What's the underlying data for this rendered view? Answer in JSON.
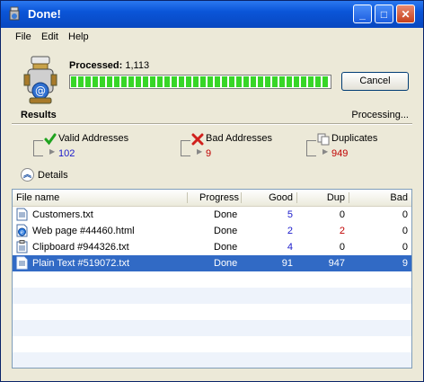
{
  "window": {
    "title": "Done!",
    "minimize_glyph": "_",
    "maximize_glyph": "□",
    "close_glyph": "✕"
  },
  "menu": [
    {
      "label": "File"
    },
    {
      "label": "Edit"
    },
    {
      "label": "Help"
    }
  ],
  "progress": {
    "processed_label": "Processed:",
    "processed_count": "1,113",
    "fraction": 1.0,
    "cancel_label": "Cancel"
  },
  "results": {
    "title": "Results",
    "status": "Processing...",
    "valid": {
      "label": "Valid Addresses",
      "value": "102",
      "icon": "green-check-icon"
    },
    "bad": {
      "label": "Bad Addresses",
      "value": "9",
      "icon": "red-x-icon"
    },
    "duplicates": {
      "label": "Duplicates",
      "value": "949",
      "icon": "duplicates-icon"
    },
    "details_label": "Details"
  },
  "table": {
    "columns": {
      "name": "File name",
      "progress": "Progress",
      "good": "Good",
      "dup": "Dup",
      "bad": "Bad"
    },
    "rows": [
      {
        "name": "Customers.txt",
        "icon": "text-file-icon",
        "progress": "Done",
        "good": "5",
        "dup": "0",
        "bad": "0"
      },
      {
        "name": "Web page #44460.html",
        "icon": "web-page-icon",
        "progress": "Done",
        "good": "2",
        "dup": "2",
        "bad": "0"
      },
      {
        "name": "Clipboard #944326.txt",
        "icon": "clipboard-icon",
        "progress": "Done",
        "good": "4",
        "dup": "0",
        "bad": "0"
      },
      {
        "name": "Plain Text #519072.txt",
        "icon": "text-file-icon",
        "progress": "Done",
        "good": "91",
        "dup": "947",
        "bad": "9"
      }
    ]
  },
  "colors": {
    "titlebar": "#0a55d8",
    "progress_fill": "#37d627",
    "selected_row": "#316ac5",
    "count_blue": "#1a1acb",
    "count_red": "#c00000"
  }
}
